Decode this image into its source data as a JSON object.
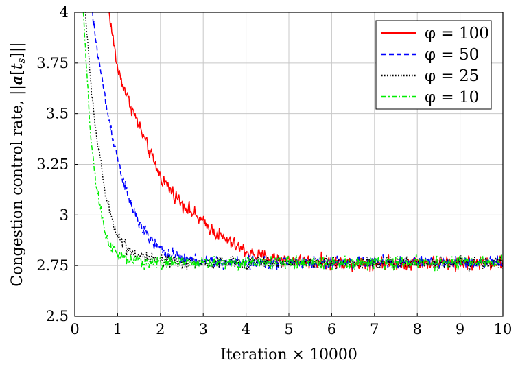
{
  "chart_data": {
    "type": "line",
    "xlabel": "Iteration × 10000",
    "ylabel": "Congestion control rate, ||a[t_s]||",
    "xlim": [
      0,
      10
    ],
    "ylim": [
      2.5,
      4
    ],
    "xticks": [
      0,
      1,
      2,
      3,
      4,
      5,
      6,
      7,
      8,
      9,
      10
    ],
    "yticks": [
      2.5,
      2.75,
      3,
      3.25,
      3.5,
      3.75,
      4
    ],
    "ytick_labels": [
      "2.5",
      "2.75",
      "3",
      "3.25",
      "3.5",
      "3.75",
      "4"
    ],
    "grid": true,
    "legend_position": "top-right",
    "series": [
      {
        "name": "φ = 100",
        "color": "#ff0000",
        "dash": "solid",
        "x": [
          0.8,
          1.0,
          1.25,
          1.5,
          1.75,
          2.0,
          2.25,
          2.5,
          2.75,
          3.0,
          3.25,
          3.5,
          3.75,
          4.0,
          4.25,
          4.5,
          5.0,
          6.0,
          7.0,
          8.0,
          9.0,
          10.0
        ],
        "y": [
          4.0,
          3.72,
          3.57,
          3.44,
          3.31,
          3.19,
          3.12,
          3.06,
          3.01,
          2.96,
          2.92,
          2.88,
          2.85,
          2.82,
          2.8,
          2.79,
          2.775,
          2.765,
          2.765,
          2.765,
          2.765,
          2.765
        ],
        "noise": 0.022
      },
      {
        "name": "φ = 50",
        "color": "#0000ff",
        "dash": "dashed",
        "x": [
          0.4,
          0.5,
          0.75,
          1.0,
          1.25,
          1.5,
          1.75,
          2.0,
          2.25,
          2.5,
          3.0,
          3.5,
          4.0,
          5.0,
          6.0,
          7.0,
          8.0,
          9.0,
          10.0
        ],
        "y": [
          4.0,
          3.85,
          3.52,
          3.28,
          3.08,
          2.96,
          2.88,
          2.83,
          2.8,
          2.785,
          2.77,
          2.765,
          2.765,
          2.765,
          2.765,
          2.765,
          2.765,
          2.765,
          2.765
        ],
        "noise": 0.02
      },
      {
        "name": "φ = 25",
        "color": "#000000",
        "dash": "dotted",
        "x": [
          0.25,
          0.35,
          0.5,
          0.75,
          1.0,
          1.25,
          1.5,
          1.75,
          2.0,
          2.5,
          3.0,
          4.0,
          5.0,
          6.0,
          7.0,
          8.0,
          9.0,
          10.0
        ],
        "y": [
          4.0,
          3.7,
          3.4,
          3.06,
          2.9,
          2.83,
          2.8,
          2.78,
          2.77,
          2.765,
          2.765,
          2.765,
          2.765,
          2.765,
          2.765,
          2.765,
          2.765,
          2.765
        ],
        "noise": 0.02
      },
      {
        "name": "φ = 10",
        "color": "#00ee00",
        "dash": "dashdot",
        "x": [
          0.2,
          0.25,
          0.35,
          0.5,
          0.75,
          1.0,
          1.25,
          1.5,
          2.0,
          2.5,
          3.0,
          4.0,
          5.0,
          6.0,
          7.0,
          8.0,
          9.0,
          10.0
        ],
        "y": [
          4.0,
          3.8,
          3.45,
          3.13,
          2.88,
          2.8,
          2.78,
          2.77,
          2.765,
          2.765,
          2.765,
          2.765,
          2.765,
          2.765,
          2.765,
          2.765,
          2.765,
          2.765
        ],
        "noise": 0.02
      }
    ]
  }
}
